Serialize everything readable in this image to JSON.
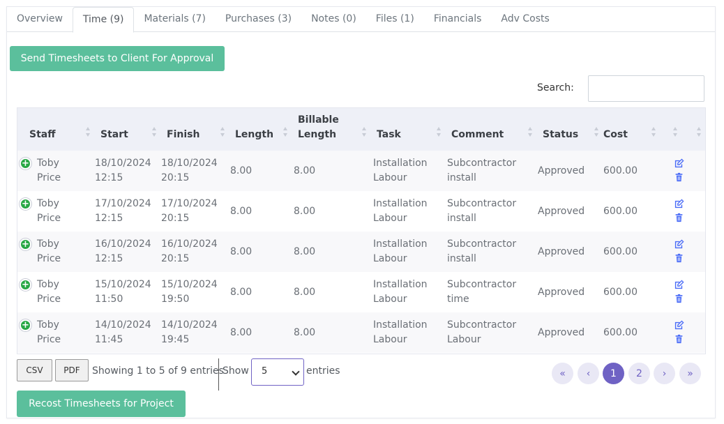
{
  "tabs": [
    {
      "label": "Overview"
    },
    {
      "label": "Time (9)"
    },
    {
      "label": "Materials (7)"
    },
    {
      "label": "Purchases (3)"
    },
    {
      "label": "Notes (0)"
    },
    {
      "label": "Files (1)"
    },
    {
      "label": "Financials"
    },
    {
      "label": "Adv Costs"
    }
  ],
  "active_tab": "Time (9)",
  "send_button": "Send Timesheets to Client For Approval",
  "search": {
    "label": "Search:",
    "value": ""
  },
  "table": {
    "headers": {
      "staff": "Staff",
      "start": "Start",
      "finish": "Finish",
      "length": "Length",
      "billable_1": "Billable",
      "billable_2": "Length",
      "task": "Task",
      "comment": "Comment",
      "status": "Status",
      "cost": "Cost"
    },
    "rows": [
      {
        "staff1": "Toby",
        "staff2": "Price",
        "start1": "18/10/2024",
        "start2": "12:15",
        "finish1": "18/10/2024",
        "finish2": "20:15",
        "length": "8.00",
        "billable": "8.00",
        "task1": "Installation",
        "task2": "Labour",
        "comment1": "Subcontractor",
        "comment2": "install",
        "status": "Approved",
        "cost": "600.00"
      },
      {
        "staff1": "Toby",
        "staff2": "Price",
        "start1": "17/10/2024",
        "start2": "12:15",
        "finish1": "17/10/2024",
        "finish2": "20:15",
        "length": "8.00",
        "billable": "8.00",
        "task1": "Installation",
        "task2": "Labour",
        "comment1": "Subcontractor",
        "comment2": "install",
        "status": "Approved",
        "cost": "600.00"
      },
      {
        "staff1": "Toby",
        "staff2": "Price",
        "start1": "16/10/2024",
        "start2": "12:15",
        "finish1": "16/10/2024",
        "finish2": "20:15",
        "length": "8.00",
        "billable": "8.00",
        "task1": "Installation",
        "task2": "Labour",
        "comment1": "Subcontractor",
        "comment2": "install",
        "status": "Approved",
        "cost": "600.00"
      },
      {
        "staff1": "Toby",
        "staff2": "Price",
        "start1": "15/10/2024",
        "start2": "11:50",
        "finish1": "15/10/2024",
        "finish2": "19:50",
        "length": "8.00",
        "billable": "8.00",
        "task1": "Installation",
        "task2": "Labour",
        "comment1": "Subcontractor",
        "comment2": "time",
        "status": "Approved",
        "cost": "600.00"
      },
      {
        "staff1": "Toby",
        "staff2": "Price",
        "start1": "14/10/2024",
        "start2": "11:45",
        "finish1": "14/10/2024",
        "finish2": "19:45",
        "length": "8.00",
        "billable": "8.00",
        "task1": "Installation",
        "task2": "Labour",
        "comment1": "Subcontractor",
        "comment2": "Labour",
        "status": "Approved",
        "cost": "600.00"
      }
    ]
  },
  "footer": {
    "csv": "CSV",
    "pdf": "PDF",
    "showing": "Showing 1 to 5 of 9 entries",
    "show": "Show",
    "page_size": "5",
    "entries": "entries",
    "pages": [
      {
        "label": "«"
      },
      {
        "label": "‹"
      },
      {
        "label": "1"
      },
      {
        "label": "2"
      },
      {
        "label": "›"
      },
      {
        "label": "»"
      }
    ],
    "current_page": "1"
  },
  "recost_button": "Recost Timesheets for Project",
  "colors": {
    "accent_green": "#5bbf9c",
    "pager_purple": "#6f62c4",
    "add_icon_green": "#28a745",
    "action_blue": "#4a6cf7"
  },
  "icons": {
    "add": "plus-circle-icon",
    "edit": "edit-icon",
    "delete": "trash-icon"
  }
}
